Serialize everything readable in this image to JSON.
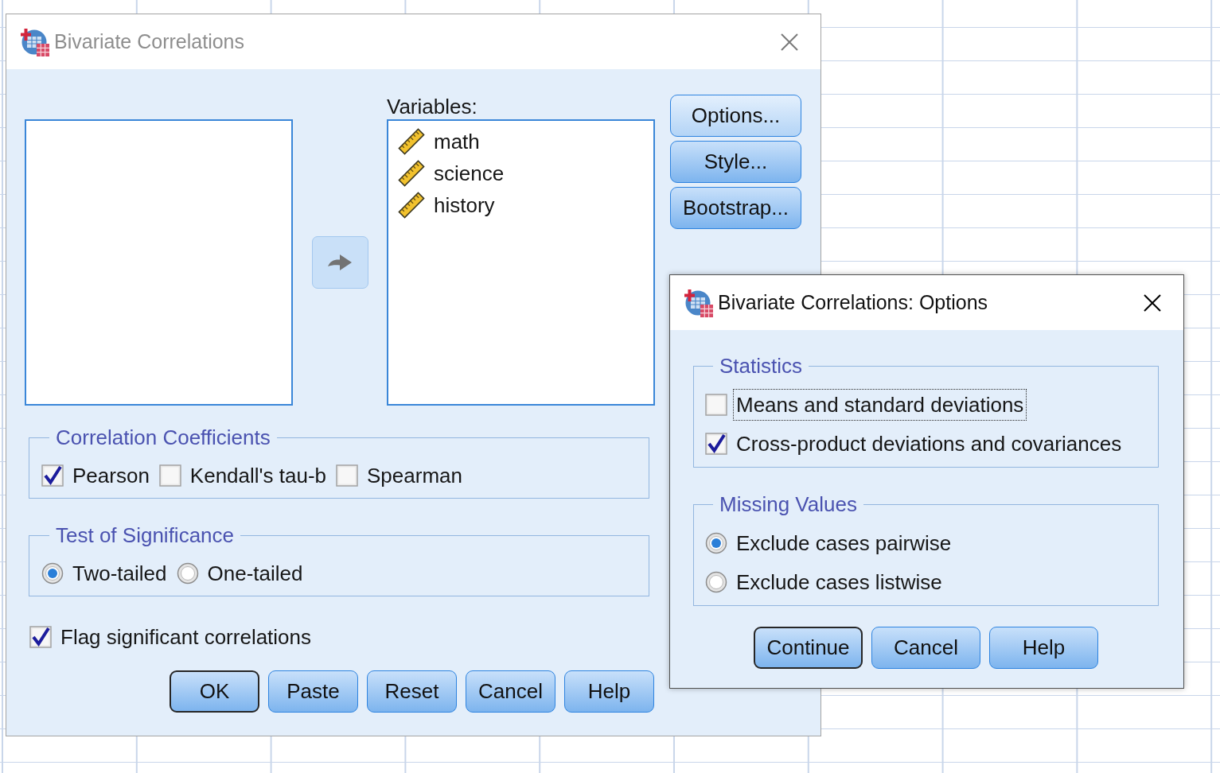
{
  "main_dialog": {
    "title": "Bivariate Correlations",
    "active": false,
    "move_button": {
      "disabled": true
    },
    "variables": {
      "label": "Variables:",
      "items": [
        {
          "name": "math"
        },
        {
          "name": "science"
        },
        {
          "name": "history"
        }
      ]
    },
    "side_buttons": [
      {
        "label": "Options...",
        "hovered": true
      },
      {
        "label": "Style...",
        "hovered": false
      },
      {
        "label": "Bootstrap...",
        "hovered": false
      }
    ],
    "correlation_coefficients": {
      "title": "Correlation Coefficients",
      "options": [
        {
          "label": "Pearson",
          "checked": true
        },
        {
          "label": "Kendall's tau-b",
          "checked": false
        },
        {
          "label": "Spearman",
          "checked": false
        }
      ]
    },
    "test_of_significance": {
      "title": "Test of Significance",
      "options": [
        {
          "label": "Two-tailed",
          "selected": true
        },
        {
          "label": "One-tailed",
          "selected": false
        }
      ]
    },
    "flag_significant": {
      "label": "Flag significant correlations",
      "checked": true
    },
    "buttons": [
      {
        "label": "OK",
        "default": true
      },
      {
        "label": "Paste",
        "default": false
      },
      {
        "label": "Reset",
        "default": false
      },
      {
        "label": "Cancel",
        "default": false
      },
      {
        "label": "Help",
        "default": false
      }
    ]
  },
  "options_dialog": {
    "title": "Bivariate Correlations: Options",
    "active": true,
    "statistics": {
      "title": "Statistics",
      "options": [
        {
          "label": "Means and standard deviations",
          "checked": false,
          "focused": true
        },
        {
          "label": "Cross-product deviations and covariances",
          "checked": true,
          "focused": false
        }
      ]
    },
    "missing_values": {
      "title": "Missing Values",
      "options": [
        {
          "label": "Exclude cases pairwise",
          "selected": true
        },
        {
          "label": "Exclude cases listwise",
          "selected": false
        }
      ]
    },
    "buttons": [
      {
        "label": "Continue",
        "default": true
      },
      {
        "label": "Cancel",
        "default": false
      },
      {
        "label": "Help",
        "default": false
      }
    ]
  }
}
